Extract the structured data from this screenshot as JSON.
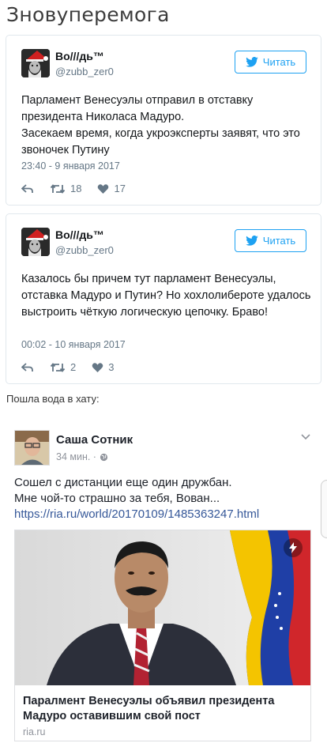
{
  "page_title": "Зновуперемога",
  "tweets": [
    {
      "author_name": "Во///дь™",
      "handle": "@zubb_zer0",
      "follow_label": "Читать",
      "text_lines": [
        "Парламент Венесуэлы отправил в отставку президента Николаса Мадуро.",
        "Засекаем время, когда укроэксперты заявят, что это звоночек Путину"
      ],
      "date": "23:40 - 9 января 2017",
      "retweets": "18",
      "likes": "17"
    },
    {
      "author_name": "Во///дь™",
      "handle": "@zubb_zer0",
      "follow_label": "Читать",
      "text_lines": [
        "Казалось бы причем тут парламент Венесуэлы, отставка Мадуро и Путин? Но хохлолиберотe удалось выстроить чёткую логическую цепочку. Браво!"
      ],
      "date": "00:02 - 10 января 2017",
      "retweets": "2",
      "likes": "3"
    }
  ],
  "caption": "Пошла вода в хату:",
  "fb_post": {
    "author_name": "Саша Сотник",
    "time": "34 мин. ·",
    "text_line_1": "Сошел с дистанции еще один дружбан.",
    "text_line_2": "Мне чой-то страшно за тебя, Вован...",
    "link": "https://ria.ru/world/20170109/1485363247.html",
    "card_title": "Паралмент Венесуэлы объявил президента Мадуро оставившим свой пост",
    "card_domain": "ria.ru"
  },
  "colors": {
    "twitter_blue": "#1da1f2",
    "fb_link": "#365899",
    "flag_yellow": "#f4c400",
    "flag_blue": "#1f3fa6",
    "flag_red": "#d0262b"
  },
  "icons": [
    "twitter-bird-icon",
    "reply-icon",
    "retweet-icon",
    "heart-icon",
    "globe-icon",
    "chevron-down-icon",
    "lightning-icon"
  ]
}
